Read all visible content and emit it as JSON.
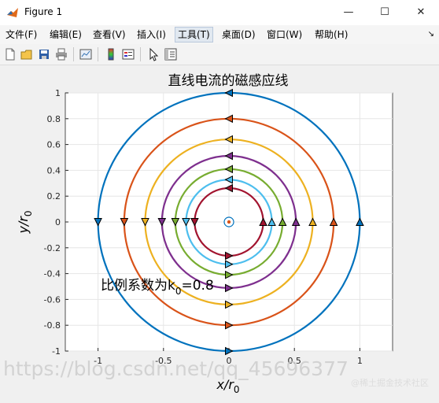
{
  "window": {
    "title": "Figure 1",
    "minimize_icon": "minimize-icon",
    "maximize_icon": "maximize-icon",
    "close_icon": "close-icon"
  },
  "menu": {
    "items": [
      {
        "label": "文件(F)"
      },
      {
        "label": "编辑(E)"
      },
      {
        "label": "查看(V)"
      },
      {
        "label": "插入(I)"
      },
      {
        "label": "工具(T)"
      },
      {
        "label": "桌面(D)"
      },
      {
        "label": "窗口(W)"
      },
      {
        "label": "帮助(H)"
      }
    ],
    "active_index": 4
  },
  "toolbar": {
    "icons": [
      "new-figure-icon",
      "open-icon",
      "save-icon",
      "print-icon",
      "link-plot-icon",
      "colorbar-icon",
      "legend-icon",
      "pointer-icon",
      "property-editor-icon"
    ]
  },
  "plot": {
    "title": "直线电流的磁感应线",
    "xlabel_main": "x/r",
    "xlabel_sub": "0",
    "ylabel_main": "y/r",
    "ylabel_sub": "0",
    "annotation_main": "比例系数为k",
    "annotation_sub": "0",
    "annotation_value": "=0.8",
    "watermark": "https://blog.csdn.net/qq_45696377",
    "badge": "@稀土掘金技术社区"
  },
  "chart_data": {
    "type": "line",
    "title": "直线电流的磁感应线",
    "xlabel": "x/r0",
    "ylabel": "y/r0",
    "xlim": [
      -1.25,
      1.25
    ],
    "ylim": [
      -1,
      1
    ],
    "grid": true,
    "xticks": [
      "-1",
      "-0.5",
      "0",
      "0.5",
      "1"
    ],
    "yticks": [
      "1",
      "0.8",
      "0.6",
      "0.4",
      "0.2",
      "0",
      "-0.2",
      "-0.4",
      "-0.6",
      "-0.8",
      "-1"
    ],
    "series": [
      {
        "radius": 1.0,
        "color": "#0072bd"
      },
      {
        "radius": 0.8,
        "color": "#d95319"
      },
      {
        "radius": 0.64,
        "color": "#edb120"
      },
      {
        "radius": 0.512,
        "color": "#7e2f8e"
      },
      {
        "radius": 0.4096,
        "color": "#77ac30"
      },
      {
        "radius": 0.3277,
        "color": "#4dbeee"
      },
      {
        "radius": 0.2621,
        "color": "#a2142f"
      }
    ],
    "center_marker": {
      "x": 0,
      "y": 0
    },
    "k0": 0.8
  }
}
